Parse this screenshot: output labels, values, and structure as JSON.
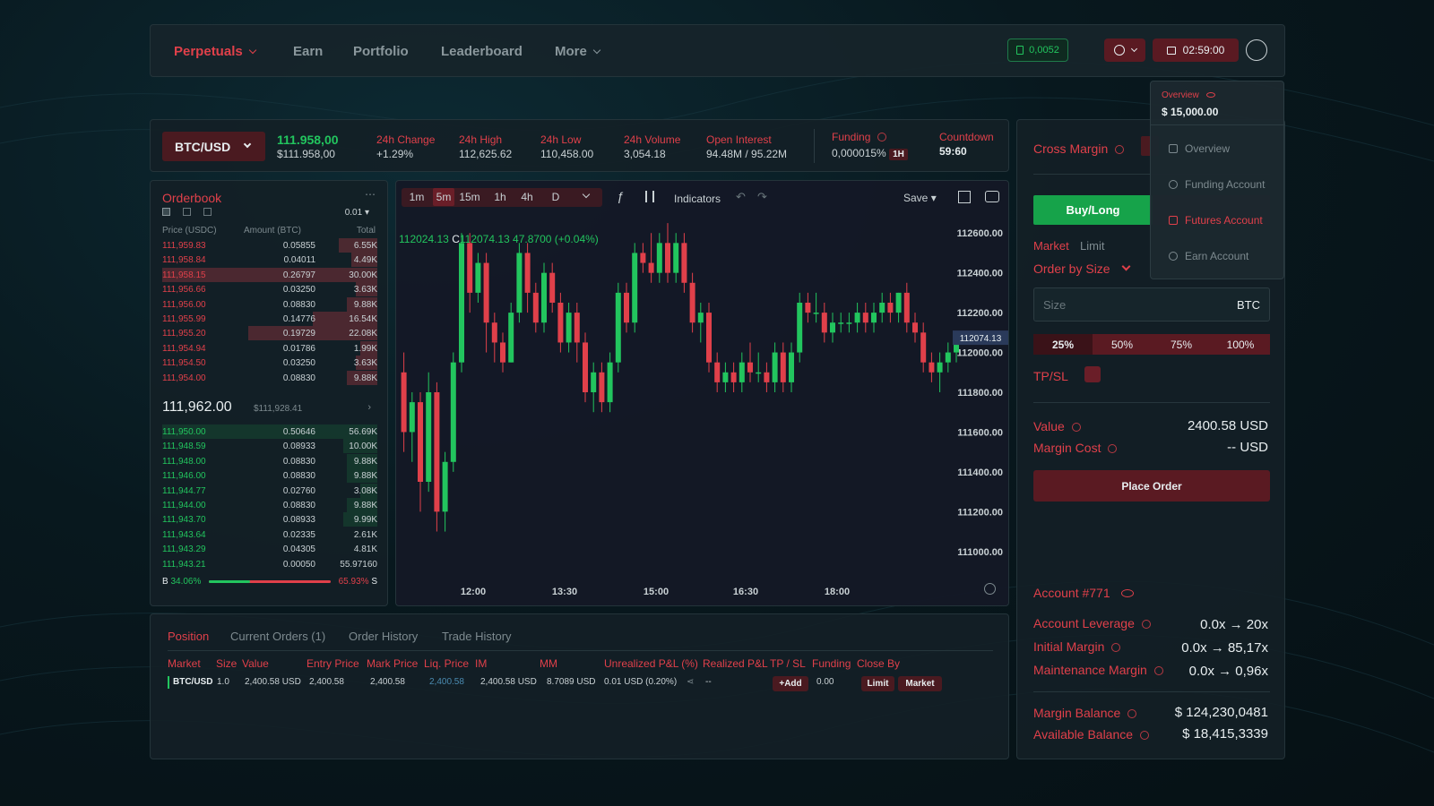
{
  "nav": {
    "items": [
      {
        "label": "Perpetuals",
        "active": true,
        "dropdown": true
      },
      {
        "label": "Earn"
      },
      {
        "label": "Portfolio"
      },
      {
        "label": "Leaderboard"
      },
      {
        "label": "More",
        "dropdown": true
      }
    ],
    "wallet_value": "0,0052",
    "timer": "02:59:00"
  },
  "ticker": {
    "pair": "BTC/USD",
    "price": "111.958,00",
    "price_sub": "$111.958,00",
    "stats": [
      {
        "label": "24h Change",
        "value": "+1.29%",
        "color": "green"
      },
      {
        "label": "24h High",
        "value": "112,625.62"
      },
      {
        "label": "24h Low",
        "value": "110,458.00"
      },
      {
        "label": "24h Volume",
        "value": "3,054.18"
      },
      {
        "label": "Open Interest",
        "value": "94.48M / 95.22M",
        "color": "green"
      }
    ],
    "funding_label": "Funding",
    "funding_value": "0,000015%",
    "funding_interval": "1H",
    "countdown_label": "Countdown",
    "countdown_value": "59:60"
  },
  "orderbook": {
    "title": "Orderbook",
    "precision": "0.01",
    "headers": {
      "price": "Price (USDC)",
      "amount": "Amount (BTC)",
      "total": "Total"
    },
    "asks": [
      {
        "price": "111,959.83",
        "amount": "0.05855",
        "total": "6.55K",
        "depth": 0.18
      },
      {
        "price": "111,958.84",
        "amount": "0.04011",
        "total": "4.49K",
        "depth": 0.12
      },
      {
        "price": "111,958.15",
        "amount": "0.26797",
        "total": "30.00K",
        "depth": 1.0
      },
      {
        "price": "111,956.66",
        "amount": "0.03250",
        "total": "3.63K",
        "depth": 0.1
      },
      {
        "price": "111,956.00",
        "amount": "0.08830",
        "total": "9.88K",
        "depth": 0.14
      },
      {
        "price": "111,955.99",
        "amount": "0.14776",
        "total": "16.54K",
        "depth": 0.3
      },
      {
        "price": "111,955.20",
        "amount": "0.19729",
        "total": "22.08K",
        "depth": 0.6
      },
      {
        "price": "111,954.94",
        "amount": "0.01786",
        "total": "1.99K",
        "depth": 0.08
      },
      {
        "price": "111,954.50",
        "amount": "0.03250",
        "total": "3.63K",
        "depth": 0.1
      },
      {
        "price": "111,954.00",
        "amount": "0.08830",
        "total": "9.88K",
        "depth": 0.14
      }
    ],
    "mid_price": "111,962.00",
    "mid_sub": "$111,928.41",
    "bids": [
      {
        "price": "111,950.00",
        "amount": "0.50646",
        "total": "56.69K",
        "depth": 1.0
      },
      {
        "price": "111,948.59",
        "amount": "0.08933",
        "total": "10.00K",
        "depth": 0.16
      },
      {
        "price": "111,948.00",
        "amount": "0.08830",
        "total": "9.88K",
        "depth": 0.14
      },
      {
        "price": "111,946.00",
        "amount": "0.08830",
        "total": "9.88K",
        "depth": 0.14
      },
      {
        "price": "111,944.77",
        "amount": "0.02760",
        "total": "3.08K",
        "depth": 0.08
      },
      {
        "price": "111,944.00",
        "amount": "0.08830",
        "total": "9.88K",
        "depth": 0.14
      },
      {
        "price": "111,943.70",
        "amount": "0.08933",
        "total": "9.99K",
        "depth": 0.16
      },
      {
        "price": "111,943.64",
        "amount": "0.02335",
        "total": "2.61K",
        "depth": 0.0
      },
      {
        "price": "111,943.29",
        "amount": "0.04305",
        "total": "4.81K",
        "depth": 0.0
      },
      {
        "price": "111,943.21",
        "amount": "0.00050",
        "total": "55.97160",
        "depth": 0.0
      }
    ],
    "buy_pct": "34.06%",
    "sell_pct": "65.93%",
    "buy_ratio": 0.34,
    "b_label": "B",
    "s_label": "S"
  },
  "chart_toolbar": {
    "timeframes": [
      "1m",
      "5m",
      "15m",
      "1h",
      "4h",
      "D"
    ],
    "active_timeframe": "5m",
    "indicators": "Indicators",
    "save": "Save"
  },
  "chart_data": {
    "type": "candlestick",
    "ohlc_text": {
      "h": "112024.13",
      "c_label": "C",
      "c": "112074.13",
      "change": "47.8700 (+0.04%)"
    },
    "last_price": "112074.13",
    "ylim": [
      110900,
      112700
    ],
    "y_ticks": [
      "112600.00",
      "112400.00",
      "112200.00",
      "112000.00",
      "111800.00",
      "111600.00",
      "111400.00",
      "111200.00",
      "111000.00"
    ],
    "x_ticks": [
      "12:00",
      "13:30",
      "15:00",
      "16:30",
      "18:00"
    ],
    "candles": [
      [
        111900,
        111600,
        112000,
        111500
      ],
      [
        111600,
        111750,
        111800,
        111450
      ],
      [
        111750,
        111350,
        111800,
        111200
      ],
      [
        111350,
        111800,
        111900,
        111300
      ],
      [
        111800,
        111200,
        111850,
        111100
      ],
      [
        111200,
        111450,
        111500,
        111100
      ],
      [
        111450,
        111950,
        112000,
        111400
      ],
      [
        111950,
        112550,
        112600,
        111900
      ],
      [
        112550,
        112300,
        112600,
        112200
      ],
      [
        112300,
        112450,
        112500,
        112250
      ],
      [
        112450,
        112150,
        112500,
        112000
      ],
      [
        112150,
        112050,
        112200,
        111950
      ],
      [
        112050,
        111950,
        112100,
        111900
      ],
      [
        111950,
        112200,
        112250,
        111950
      ],
      [
        112200,
        112500,
        112550,
        112150
      ],
      [
        112500,
        112300,
        112550,
        112200
      ],
      [
        112300,
        112150,
        112350,
        112100
      ],
      [
        112150,
        112400,
        112450,
        112100
      ],
      [
        112400,
        112250,
        112450,
        112200
      ],
      [
        112250,
        112050,
        112300,
        112000
      ],
      [
        112050,
        112200,
        112250,
        112000
      ],
      [
        112200,
        112050,
        112250,
        111950
      ],
      [
        112050,
        111800,
        112100,
        111750
      ],
      [
        111800,
        111900,
        111950,
        111700
      ],
      [
        111900,
        111750,
        111950,
        111700
      ],
      [
        111750,
        111950,
        112000,
        111700
      ],
      [
        111950,
        112300,
        112350,
        111900
      ],
      [
        112300,
        112150,
        112350,
        112100
      ],
      [
        112150,
        112500,
        112550,
        112100
      ],
      [
        112500,
        112450,
        112550,
        112400
      ],
      [
        112450,
        112400,
        112600,
        112350
      ],
      [
        112400,
        112550,
        112600,
        112350
      ],
      [
        112550,
        112400,
        112650,
        112350
      ],
      [
        112400,
        112550,
        112600,
        112350
      ],
      [
        112550,
        112350,
        112600,
        112300
      ],
      [
        112350,
        112150,
        112400,
        112100
      ],
      [
        112150,
        112200,
        112250,
        112050
      ],
      [
        112200,
        111950,
        112250,
        111900
      ],
      [
        111950,
        111850,
        112000,
        111800
      ],
      [
        111850,
        111900,
        111950,
        111800
      ],
      [
        111900,
        111850,
        111950,
        111800
      ],
      [
        111850,
        111950,
        112000,
        111800
      ],
      [
        111950,
        111900,
        112050,
        111850
      ],
      [
        111900,
        111900,
        112000,
        111850
      ],
      [
        111900,
        111850,
        111950,
        111800
      ],
      [
        111850,
        112000,
        112050,
        111800
      ],
      [
        112000,
        111850,
        112050,
        111800
      ],
      [
        111850,
        112000,
        112050,
        111800
      ],
      [
        112000,
        112250,
        112300,
        111950
      ],
      [
        112250,
        112200,
        112300,
        112150
      ],
      [
        112200,
        112200,
        112300,
        112150
      ],
      [
        112200,
        112100,
        112250,
        112050
      ],
      [
        112100,
        112150,
        112200,
        112050
      ],
      [
        112150,
        112150,
        112200,
        112100
      ],
      [
        112150,
        112150,
        112200,
        112100
      ],
      [
        112150,
        112200,
        112250,
        112100
      ],
      [
        112200,
        112150,
        112250,
        112100
      ],
      [
        112150,
        112200,
        112250,
        112100
      ],
      [
        112200,
        112250,
        112300,
        112150
      ],
      [
        112250,
        112200,
        112300,
        112150
      ],
      [
        112200,
        112300,
        112300,
        112150
      ],
      [
        112300,
        112150,
        112350,
        112100
      ],
      [
        112150,
        112100,
        112200,
        112050
      ],
      [
        112100,
        111950,
        112150,
        111900
      ],
      [
        111950,
        111900,
        112000,
        111850
      ],
      [
        111900,
        111950,
        112000,
        111800
      ],
      [
        111950,
        112000,
        112050,
        111900
      ],
      [
        112000,
        112074,
        112100,
        111950
      ]
    ]
  },
  "positions": {
    "tabs": [
      "Position",
      "Current Orders (1)",
      "Order History",
      "Trade History"
    ],
    "headers": [
      "Market",
      "Size",
      "Value",
      "Entry Price",
      "Mark Price",
      "Liq. Price",
      "IM",
      "MM",
      "Unrealized P&L (%)",
      "Realized P&L",
      "TP / SL",
      "Funding",
      "Close By"
    ],
    "row": {
      "market": "BTC/USD",
      "size": "1.0",
      "value": "2,400.58 USD",
      "entry": "2,400.58",
      "mark": "2,400.58",
      "liq": "2,400.58",
      "im": "2,400.58 USD",
      "mm": "8.7089 USD",
      "upnl": "0.01 USD (0.20%)",
      "rpnl": "--",
      "tpsl": "+Add",
      "funding": "0.00",
      "close_limit": "Limit",
      "close_market": "Market"
    }
  },
  "trade": {
    "margin_mode": "Cross Margin",
    "buy": "Buy/Long",
    "order_types": [
      "Market",
      "Limit"
    ],
    "order_by": "Order by Size",
    "size_placeholder": "Size",
    "size_unit": "BTC",
    "pcts": [
      "25%",
      "50%",
      "75%",
      "100%"
    ],
    "tpsl": "TP/SL",
    "value_label": "Value",
    "value": "2400.58 USD",
    "margin_cost_label": "Margin Cost",
    "margin_cost": "-- USD",
    "place_order": "Place Order",
    "account": "Account #771",
    "account_rows": [
      {
        "label": "Account Leverage",
        "value": "0.0x → 20x"
      },
      {
        "label": "Initial Margin",
        "value": "0.0x → 85,17x"
      },
      {
        "label": "Maintenance Margin",
        "value": "0.0x → 0,96x"
      }
    ],
    "balance_rows": [
      {
        "label": "Margin Balance",
        "value": "$ 124,230,0481"
      },
      {
        "label": "Available Balance",
        "value": "$ 18,415,3339"
      }
    ]
  },
  "dropdown": {
    "overview_label": "Overview",
    "overview_value": "$ 15,000.00",
    "items": [
      "Overview",
      "Funding Account",
      "Futures Account",
      "Earn Account"
    ],
    "active": "Futures Account"
  },
  "colors": {
    "accent_red": "#e0404a",
    "green": "#22c55e",
    "candle_up": "#22c55e",
    "candle_down": "#e0404a"
  }
}
